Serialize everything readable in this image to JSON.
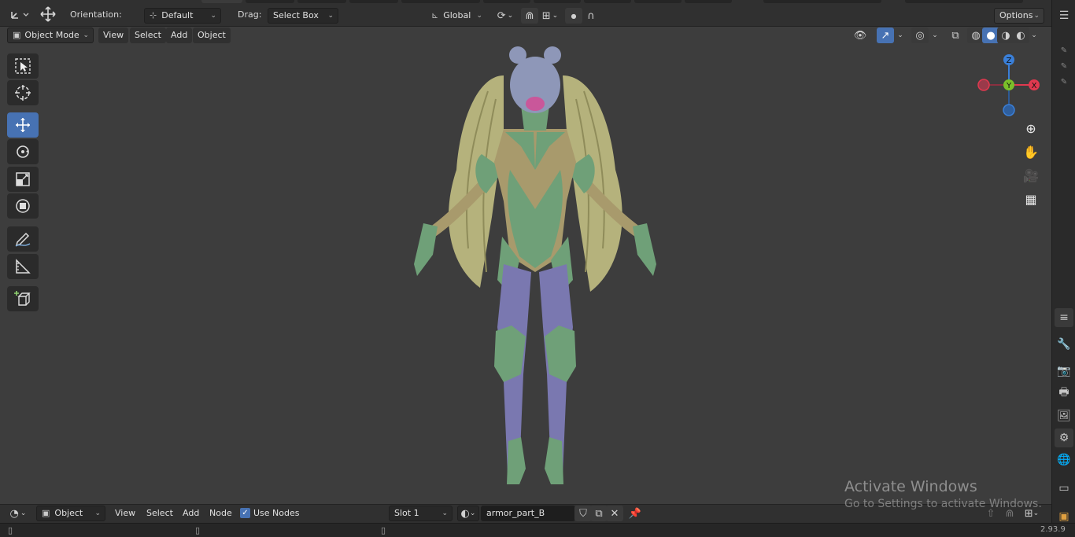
{
  "tool_header": {
    "orientation_label": "Orientation:",
    "orientation_value": "Default",
    "drag_label": "Drag:",
    "drag_value": "Select Box",
    "transform_orientation": "Global",
    "options_label": "Options"
  },
  "view_header": {
    "mode": "Object Mode",
    "menus": [
      "View",
      "Select",
      "Add",
      "Object"
    ]
  },
  "toolbar": {
    "tools": [
      "select-box",
      "cursor",
      "move",
      "rotate",
      "scale",
      "transform",
      "annotate",
      "measure",
      "add-cube"
    ],
    "active_tool": "move"
  },
  "gizmo": {
    "axes": {
      "z": "Z",
      "y": "Y",
      "x": "X"
    },
    "colors": {
      "x": "#e0394f",
      "y": "#7bbf2a",
      "z": "#3a7fd8"
    }
  },
  "node_header": {
    "editor_type": "Object",
    "menus": [
      "View",
      "Select",
      "Add",
      "Node"
    ],
    "use_nodes_label": "Use Nodes",
    "use_nodes_checked": true,
    "slot": "Slot 1",
    "material_name": "armor_part_B"
  },
  "watermark": {
    "title": "Activate Windows",
    "subtitle": "Go to Settings to activate Windows."
  },
  "status_bar": {
    "version": "2.93.9"
  },
  "colors": {
    "accent": "#4772b3",
    "viewport_bg": "#3d3d3d",
    "hair": "#b8b57a",
    "armor_green": "#6fa078",
    "armor_purple": "#7a78b0",
    "skin": "#a89a6c",
    "helmet": "#8e97b8"
  }
}
